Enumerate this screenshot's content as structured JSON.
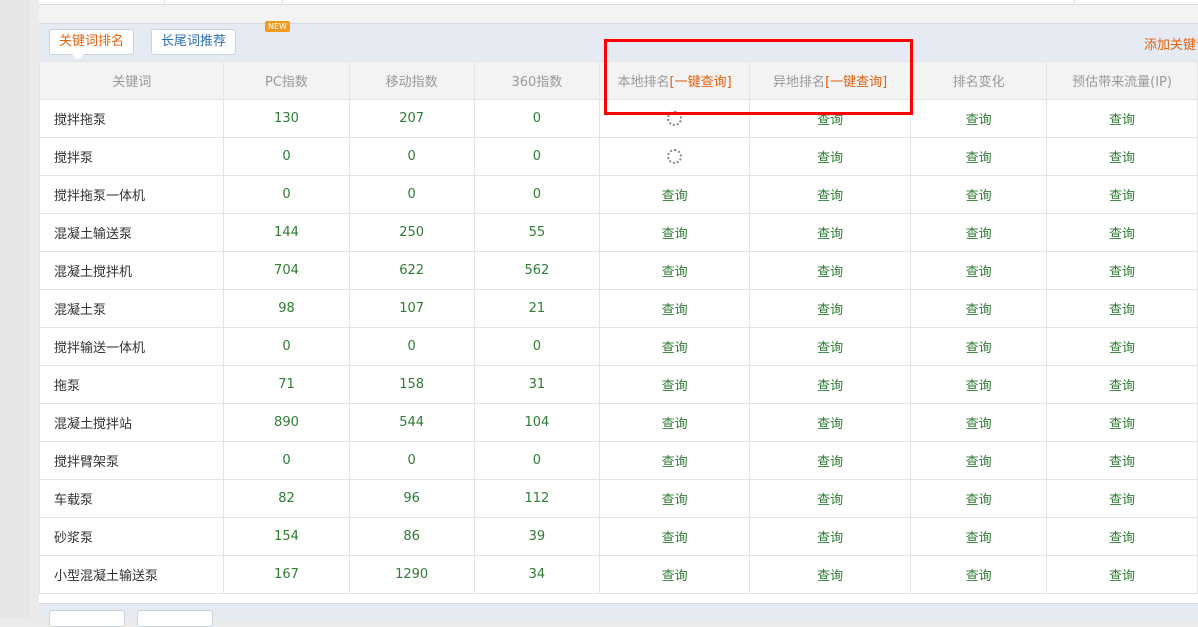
{
  "tabs": {
    "keyword_rank": "关键词排名",
    "longtail": "长尾词推荐",
    "new_badge": "NEW",
    "add_keyword": "添加关键词"
  },
  "headers": {
    "keyword": "关键词",
    "pc_index": "PC指数",
    "mobile_index": "移动指数",
    "index_360": "360指数",
    "local_rank": "本地排名",
    "local_rank_action": "[一键查询]",
    "remote_rank": "异地排名",
    "remote_rank_action": "[一键查询]",
    "rank_change": "排名变化",
    "traffic": "预估带来流量(IP)"
  },
  "query_label": "查询",
  "rows": [
    {
      "keyword": "搅拌拖泵",
      "pc": "130",
      "mobile": "207",
      "s360": "0",
      "local_loading": true
    },
    {
      "keyword": "搅拌泵",
      "pc": "0",
      "mobile": "0",
      "s360": "0",
      "local_loading": true
    },
    {
      "keyword": "搅拌拖泵一体机",
      "pc": "0",
      "mobile": "0",
      "s360": "0",
      "local_loading": false
    },
    {
      "keyword": "混凝土输送泵",
      "pc": "144",
      "mobile": "250",
      "s360": "55",
      "local_loading": false
    },
    {
      "keyword": "混凝土搅拌机",
      "pc": "704",
      "mobile": "622",
      "s360": "562",
      "local_loading": false
    },
    {
      "keyword": "混凝土泵",
      "pc": "98",
      "mobile": "107",
      "s360": "21",
      "local_loading": false
    },
    {
      "keyword": "搅拌输送一体机",
      "pc": "0",
      "mobile": "0",
      "s360": "0",
      "local_loading": false
    },
    {
      "keyword": "拖泵",
      "pc": "71",
      "mobile": "158",
      "s360": "31",
      "local_loading": false
    },
    {
      "keyword": "混凝土搅拌站",
      "pc": "890",
      "mobile": "544",
      "s360": "104",
      "local_loading": false
    },
    {
      "keyword": "搅拌臂架泵",
      "pc": "0",
      "mobile": "0",
      "s360": "0",
      "local_loading": false
    },
    {
      "keyword": "车载泵",
      "pc": "82",
      "mobile": "96",
      "s360": "112",
      "local_loading": false
    },
    {
      "keyword": "砂浆泵",
      "pc": "154",
      "mobile": "86",
      "s360": "39",
      "local_loading": false
    },
    {
      "keyword": "小型混凝土输送泵",
      "pc": "167",
      "mobile": "1290",
      "s360": "34",
      "local_loading": false
    }
  ],
  "colors": {
    "accent": "#e4620f",
    "link_blue": "#2b6fb7",
    "value_green": "#2e7d32",
    "highlight_red": "#ff0000"
  }
}
